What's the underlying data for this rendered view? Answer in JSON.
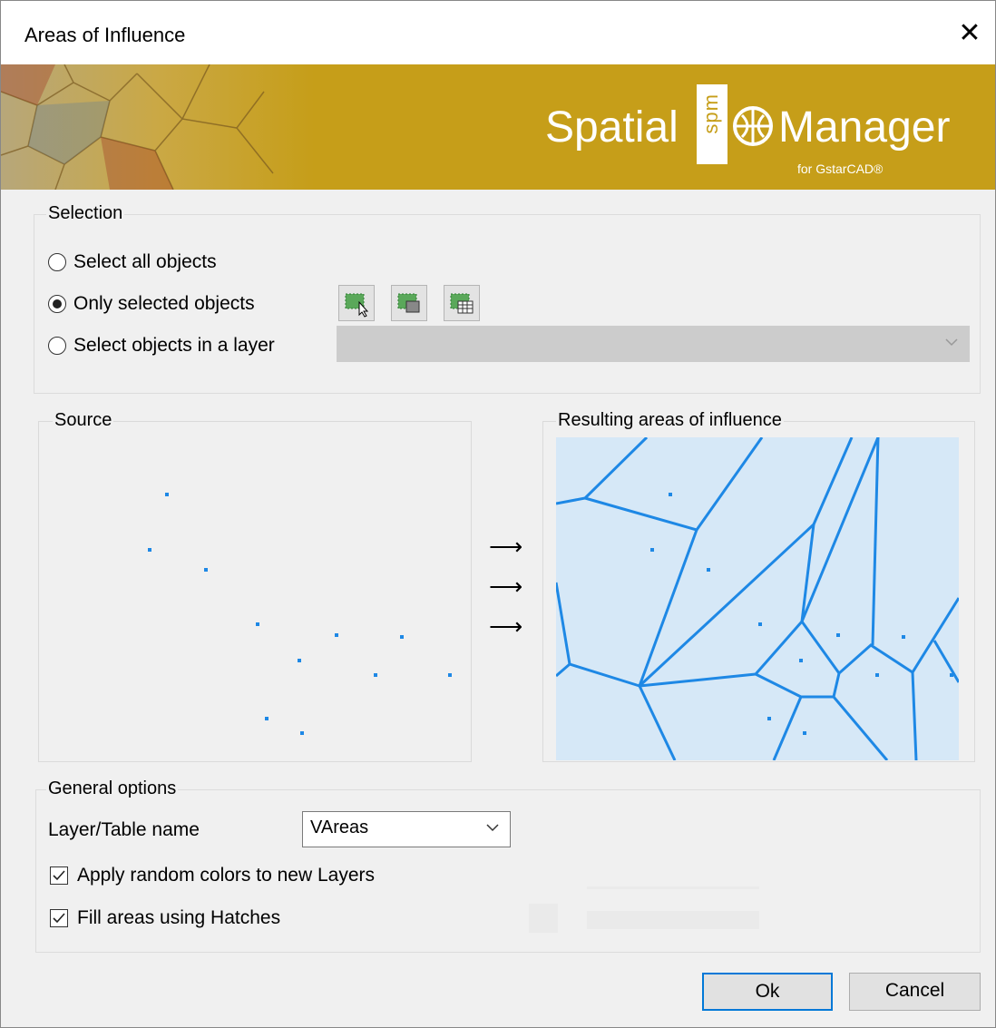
{
  "window": {
    "title": "Areas of Influence",
    "close_icon": "close-icon"
  },
  "banner": {
    "word1": "Spatial",
    "box_text": "spm",
    "word2": "Manager",
    "sub": "for GstarCAD®",
    "accent": "#c69e19"
  },
  "selection": {
    "label": "Selection",
    "options": [
      {
        "label": "Select all objects",
        "selected": false
      },
      {
        "label": "Only selected objects",
        "selected": true
      },
      {
        "label": "Select objects in a layer",
        "selected": false
      }
    ],
    "layer_value": ""
  },
  "source": {
    "label": "Source"
  },
  "result": {
    "label": "Resulting areas of influence"
  },
  "general": {
    "label": "General options",
    "layer_label": "Layer/Table name",
    "layer_value": "VAreas",
    "random_colors": {
      "label": "Apply random colors to new Layers",
      "checked": true
    },
    "fill_hatches": {
      "label": "Fill areas using Hatches",
      "checked": true
    }
  },
  "buttons": {
    "ok": "Ok",
    "cancel": "Cancel"
  }
}
